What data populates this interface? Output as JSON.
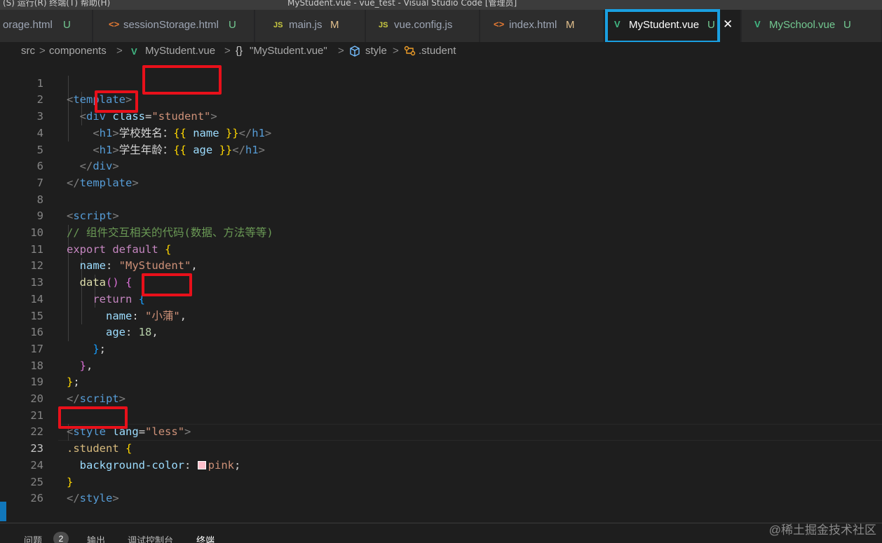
{
  "window": {
    "menu_text": "(S)   运行(R)   终端(T)   帮助(H)",
    "title": "MyStudent.vue - vue_test - Visual Studio Code [管理员]"
  },
  "tabs": [
    {
      "name": "orage.html",
      "icon": "html-icon",
      "badge": "U"
    },
    {
      "name": "sessionStorage.html",
      "icon": "html-icon",
      "icon_glyph": "<>",
      "badge": "U"
    },
    {
      "name": "main.js",
      "icon": "js-icon",
      "icon_glyph": "JS",
      "badge": "M"
    },
    {
      "name": "vue.config.js",
      "icon": "js-icon",
      "icon_glyph": "JS",
      "badge": ""
    },
    {
      "name": "index.html",
      "icon": "html-icon",
      "icon_glyph": "<>",
      "badge": "M"
    },
    {
      "name": "MyStudent.vue",
      "icon": "vue-icon",
      "icon_glyph": "V",
      "badge": "U",
      "active": true
    },
    {
      "name": "MySchool.vue",
      "icon": "vue-icon",
      "icon_glyph": "V",
      "badge": "U"
    }
  ],
  "close_glyph": "✕",
  "breadcrumb": {
    "items": [
      "src",
      "components",
      "MyStudent.vue",
      "\"MyStudent.vue\"",
      "style",
      ".student"
    ],
    "separator": ">",
    "obj_glyph": "{}"
  },
  "line_numbers": [
    "1",
    "2",
    "3",
    "4",
    "5",
    "6",
    "7",
    "8",
    "9",
    "10",
    "11",
    "12",
    "13",
    "14",
    "15",
    "16",
    "17",
    "18",
    "19",
    "20",
    "21",
    "22",
    "23",
    "24",
    "25",
    "26"
  ],
  "code": {
    "l1_tag": "template",
    "l2_tag": "div",
    "l2_attr": "class",
    "l2_val": "\"student\"",
    "l3_tag": "h1",
    "l3_text": "学校姓名：",
    "l3_var": "name",
    "l4_tag": "h1",
    "l4_text": "学生年龄：",
    "l4_var": "age",
    "l5_tag": "div",
    "l6_tag": "template",
    "l8_tag": "script",
    "l9_comment": "// 组件交互相关的代码(数据、方法等等)",
    "l10_export": "export",
    "l10_default": "default",
    "l11_key": "name",
    "l11_val": "\"MyStudent\"",
    "l12_fn": "data",
    "l13_return": "return",
    "l14_key": "name",
    "l14_val": "\"小蒲\"",
    "l15_key": "age",
    "l15_val": "18",
    "l19_tag": "script",
    "l21_tag": "style",
    "l21_attr": "lang",
    "l21_val": "\"less\"",
    "l22_selector": ".student",
    "l23_prop": "background-color",
    "l23_val": "pink",
    "l25_tag": "style",
    "swatch_color": "#ffc0cb"
  },
  "panel": {
    "tabs": [
      "问题",
      "输出",
      "调试控制台",
      "终端"
    ],
    "problems_count": "2"
  },
  "watermark": "@稀土掘金技术社区",
  "colors": {
    "highlight_blue": "#1a9fe0",
    "highlight_red": "#e8101a",
    "vue_green": "#41b883"
  }
}
